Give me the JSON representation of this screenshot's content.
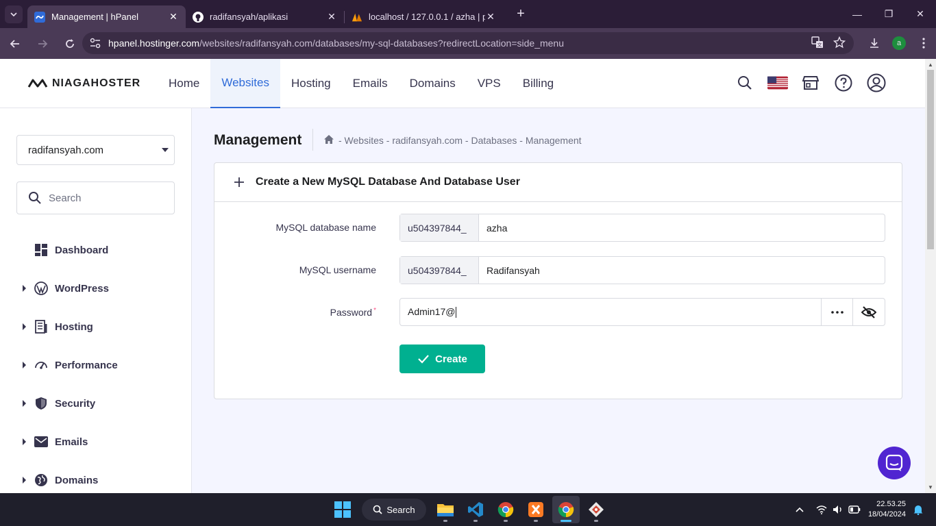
{
  "browser": {
    "tabs": [
      {
        "title": "Management | hPanel",
        "active": true
      },
      {
        "title": "radifansyah/aplikasi",
        "active": false
      },
      {
        "title": "localhost / 127.0.0.1 / azha | ph",
        "active": false
      }
    ],
    "url_host": "hpanel.hostinger.com",
    "url_path": "/websites/radifansyah.com/databases/my-sql-databases?redirectLocation=side_menu",
    "profile_initial": "a"
  },
  "header": {
    "logo_text": "NIAGAHOSTER",
    "nav": [
      {
        "label": "Home",
        "active": false
      },
      {
        "label": "Websites",
        "active": true
      },
      {
        "label": "Hosting",
        "active": false
      },
      {
        "label": "Emails",
        "active": false
      },
      {
        "label": "Domains",
        "active": false
      },
      {
        "label": "VPS",
        "active": false
      },
      {
        "label": "Billing",
        "active": false
      }
    ]
  },
  "sidebar": {
    "site_selected": "radifansyah.com",
    "search_placeholder": "Search",
    "items": [
      {
        "label": "Dashboard",
        "icon": "dashboard-icon",
        "expandable": false
      },
      {
        "label": "WordPress",
        "icon": "wordpress-icon",
        "expandable": true
      },
      {
        "label": "Hosting",
        "icon": "hosting-icon",
        "expandable": true
      },
      {
        "label": "Performance",
        "icon": "performance-icon",
        "expandable": true
      },
      {
        "label": "Security",
        "icon": "shield-icon",
        "expandable": true
      },
      {
        "label": "Emails",
        "icon": "mail-icon",
        "expandable": true
      },
      {
        "label": "Domains",
        "icon": "globe-icon",
        "expandable": true
      }
    ]
  },
  "page": {
    "title": "Management",
    "breadcrumb": "- Websites - radifansyah.com - Databases - Management",
    "card_title": "Create a New MySQL Database And Database User",
    "form": {
      "db_label": "MySQL database name",
      "db_prefix": "u504397844_",
      "db_value": "azha",
      "user_label": "MySQL username",
      "user_prefix": "u504397844_",
      "user_value": "Radifansyah",
      "password_label": "Password",
      "password_required_mark": "*",
      "password_value": "Admin17@",
      "create_label": "Create"
    }
  },
  "taskbar": {
    "search_label": "Search",
    "time": "22.53.25",
    "date": "18/04/2024"
  },
  "colors": {
    "accent": "#2f6bd8",
    "create_button": "#00b090",
    "chat_bubble": "#5025d1"
  }
}
